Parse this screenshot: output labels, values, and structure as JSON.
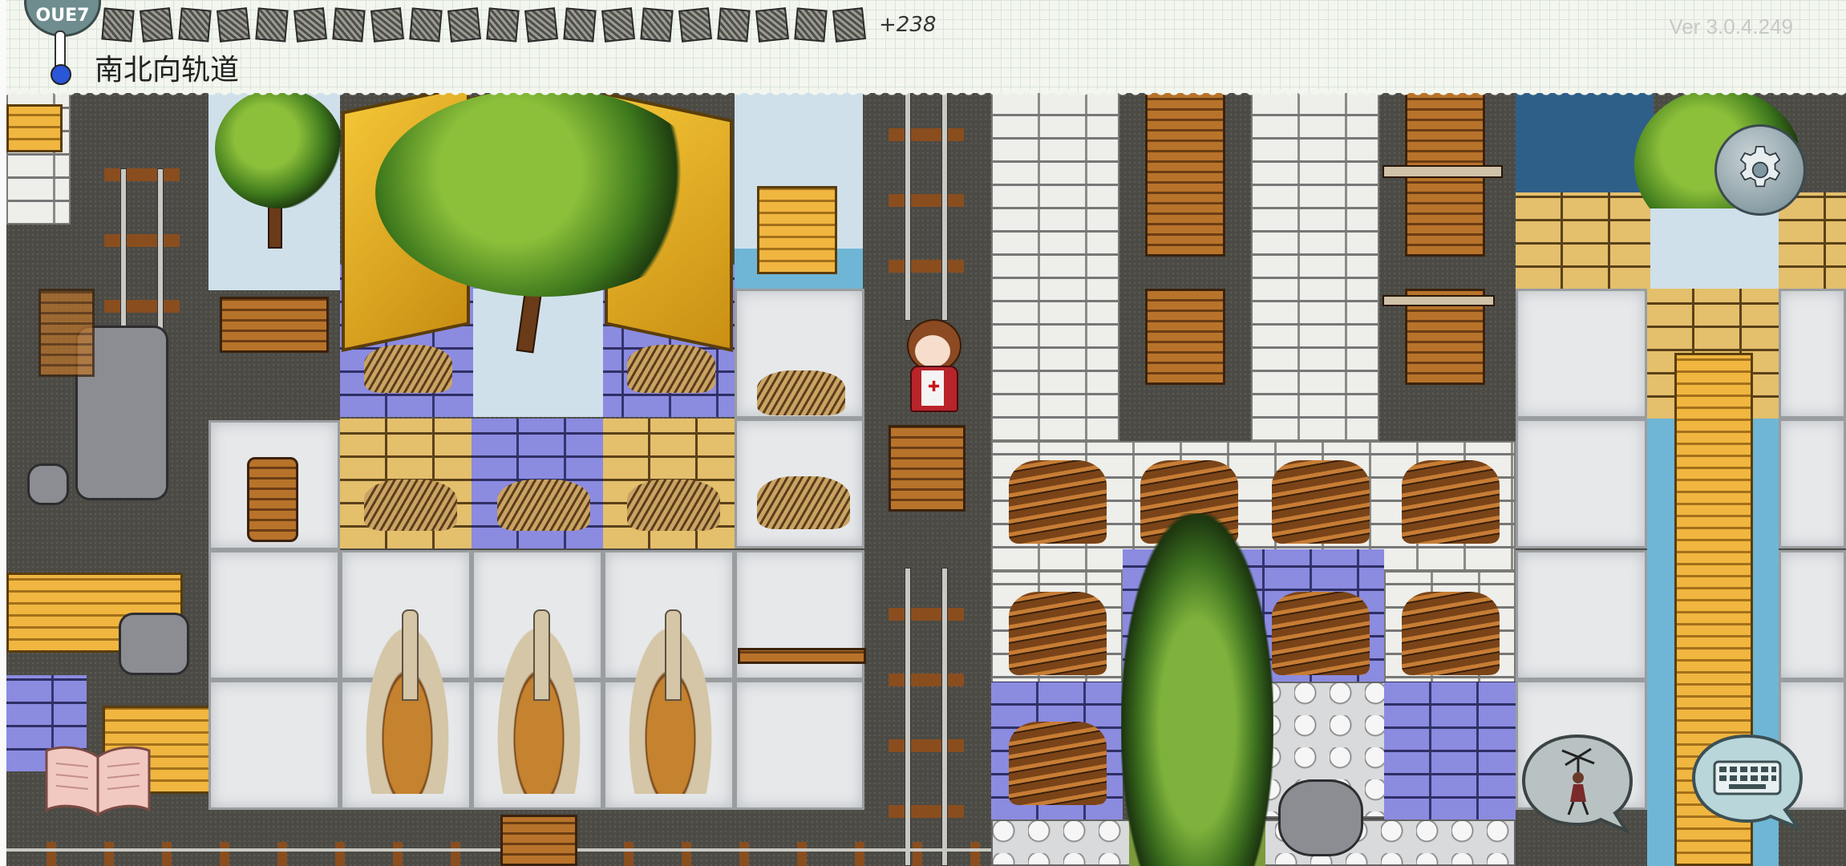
{
  "header": {
    "tile_label": "南北向轨道",
    "version": "Ver 3.0.4.249",
    "temperature_readout": "OUE7",
    "inventory_slot_count": 20,
    "inventory_overflow": "+238"
  },
  "icons": {
    "settings": "gear-icon",
    "journal": "open-book-icon",
    "puppet": "puppet-speech-bubble-icon",
    "keyboard": "keyboard-speech-bubble-icon",
    "temperature": "thermometer-icon"
  },
  "colors": {
    "paper": "#f3f6ee",
    "thermometer_bulb": "#2a56d8",
    "blue_brick": "#7a7bc9",
    "yellow_brick": "#d2a95a",
    "gold_block": "#f3c436"
  }
}
